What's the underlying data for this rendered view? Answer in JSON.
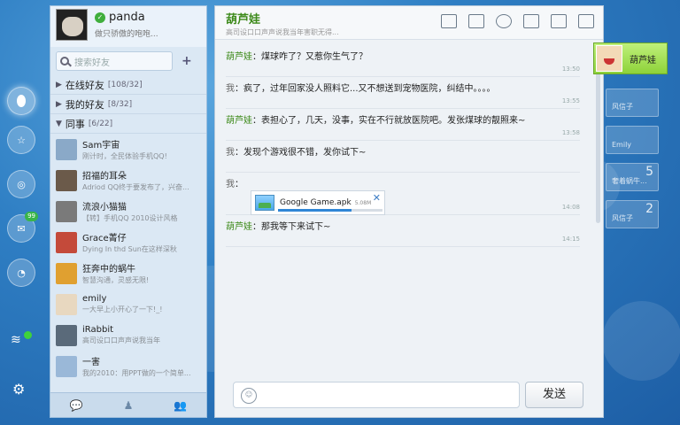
{
  "profile": {
    "name": "panda",
    "signature": "做只骄傲的咆咆..."
  },
  "search": {
    "placeholder": "搜索好友"
  },
  "groups": [
    {
      "label": "在线好友",
      "count": "[108/32]",
      "state": "collapsed"
    },
    {
      "label": "我的好友",
      "count": "[8/32]",
      "state": "collapsed"
    },
    {
      "label": "同事",
      "count": "[6/22]",
      "state": "expanded"
    }
  ],
  "contacts": [
    {
      "name": "Sam宇宙",
      "signature": "刚计时，全民体验手机QQ!",
      "avatar_color": "#8aa9c8"
    },
    {
      "name": "招福的耳朵",
      "signature": "Adriod QQ终于要发布了，兴奋...",
      "avatar_color": "#6b5a4a"
    },
    {
      "name": "流浪小猫猫",
      "signature": "【转】手机QQ 2010设计风格",
      "avatar_color": "#7a7a7a"
    },
    {
      "name": "Grace菁仔",
      "signature": "Dying In thd Sun在这样深秋",
      "avatar_color": "#c44a3a"
    },
    {
      "name": "狂奔中的蜗牛",
      "signature": "智慧沟通，灵感无限!",
      "avatar_color": "#e0a030"
    },
    {
      "name": "emily",
      "signature": "一大早上小开心了一下!_!",
      "avatar_color": "#e8d8c0"
    },
    {
      "name": "iRabbit",
      "signature": "高司设口口声声说我当年",
      "avatar_color": "#5a6a7a"
    },
    {
      "name": "一害",
      "signature": "我的2010：用PPT做的一个简单...",
      "avatar_color": "#9ab8d8"
    }
  ],
  "chat": {
    "title": "葫芦娃",
    "subtitle": "高司设口口声声说我当年害职无得...",
    "messages": [
      {
        "sender": "葫芦娃",
        "text": "煤球咋了？又惹你生气了？",
        "time": "13:50",
        "self": false
      },
      {
        "sender": "我",
        "text": "疯了，过年回家没人照料它...又不想送到宠物医院，纠结中。。。。",
        "time": "13:55",
        "self": true
      },
      {
        "sender": "葫芦娃",
        "text": "表担心了，几天，没事，实在不行就放医院吧。发张煤球的靓照来~",
        "time": "13:58",
        "self": false
      },
      {
        "sender": "我",
        "text": "发现个游戏很不错，发你试下~",
        "time": "",
        "self": true
      },
      {
        "sender": "我",
        "text": "",
        "time": "14:08",
        "self": true,
        "file": {
          "name": "Google Game.apk",
          "size": "5.08M",
          "progress": 0.7
        }
      },
      {
        "sender": "葫芦娃",
        "text": "那我等下来试下~",
        "time": "14:15",
        "self": false
      }
    ],
    "send_label": "发送"
  },
  "active_chat": {
    "name": "葫芦娃"
  },
  "other_chats": [
    {
      "name": "风信子",
      "unread": ""
    },
    {
      "name": "Emily",
      "unread": ""
    },
    {
      "name": "奢着蜗牛...",
      "unread": "5"
    },
    {
      "name": "风信子",
      "unread": "2"
    }
  ],
  "rail": {
    "badge": "99"
  },
  "colors": {
    "accent_green": "#3d8a1a",
    "background_blue": "#2f7fc4",
    "progress_blue": "#2f86d6"
  }
}
